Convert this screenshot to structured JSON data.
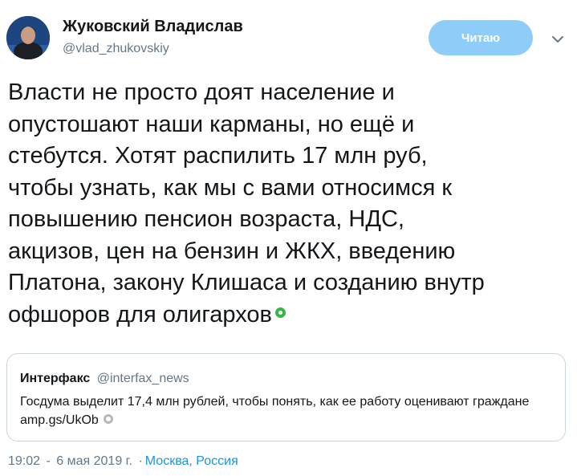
{
  "author": {
    "name": "Жуковский Владислав",
    "handle": "@vlad_zhukovskiy"
  },
  "follow_button": {
    "label": "Читаю",
    "color": "#8ecdf8"
  },
  "menu_icon": "chevron-down-icon",
  "tweet": {
    "text": "Власти не просто доят население и\nопустошают наши карманы, но ещё и\nстебутся. Хотят распилить 17 млн руб,\nчтобы узнать, как мы с вами относимся к\nповышению пенсион возраста, НДС,\nакцизов, цен на бензин и ЖКХ, введению\nПлатона, закону Клишаса и созданию внутр\nофшоров для олигархов",
    "emoji": "green-circle-emoji"
  },
  "quote": {
    "name": "Интерфакс",
    "handle": "@interfax_news",
    "text": "Госдума выделит 17,4 млн рублей, чтобы понять, как ее работу оценивают граждане amp.gs/UkOb",
    "emoji": "grey-circle-emoji"
  },
  "meta": {
    "time": "19:02",
    "separator": "-",
    "date": "6 мая 2019 г.",
    "location_separator": "·",
    "location": "Москва, Россия"
  },
  "colors": {
    "text": "#14171a",
    "secondary": "#657786",
    "link": "#1b95e0",
    "border": "#ccd6dd"
  }
}
